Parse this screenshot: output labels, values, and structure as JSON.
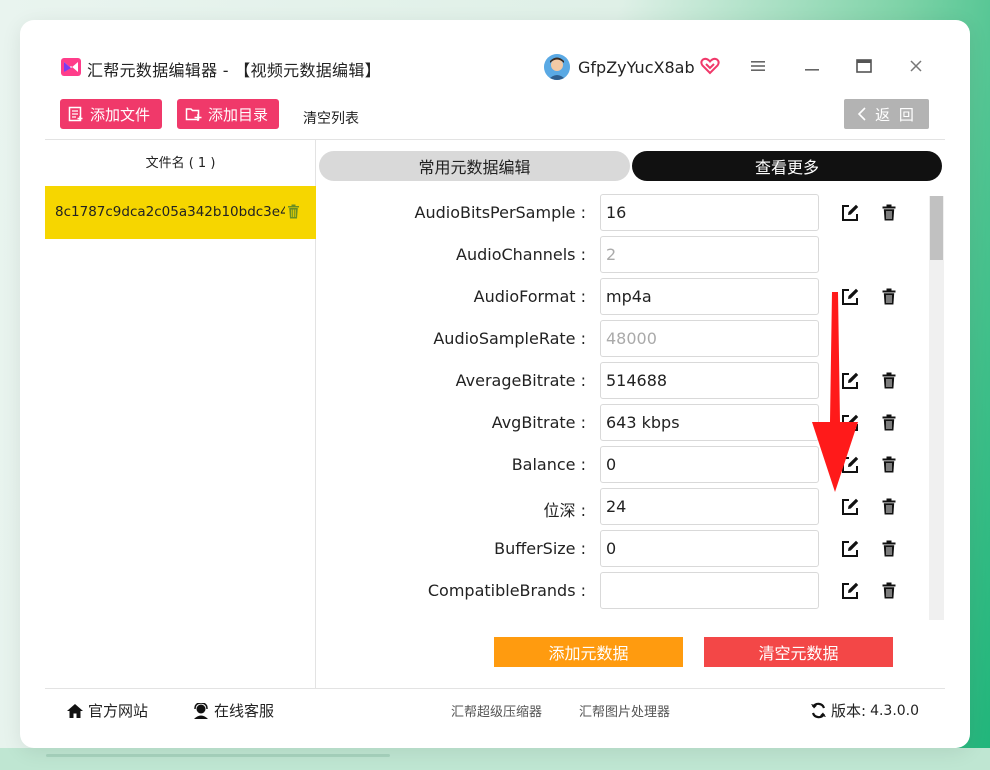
{
  "window": {
    "title": "汇帮元数据编辑器 - 【视频元数据编辑】",
    "username": "GfpZyYucX8ab"
  },
  "toolbar": {
    "add_file": "添加文件",
    "add_folder": "添加目录",
    "clear_list": "清空列表",
    "back": "返 回"
  },
  "file_list": {
    "header": "文件名 ( 1 )",
    "items": [
      {
        "name": "8c1787c9dca2c05a342b10bdc3e4"
      }
    ]
  },
  "tabs": [
    {
      "label": "常用元数据编辑",
      "active": false
    },
    {
      "label": "查看更多",
      "active": true
    }
  ],
  "metadata": [
    {
      "label": "AudioBitsPerSample :",
      "value": "16",
      "editable": true
    },
    {
      "label": "AudioChannels :",
      "value": "2",
      "editable": false
    },
    {
      "label": "AudioFormat :",
      "value": "mp4a",
      "editable": true
    },
    {
      "label": "AudioSampleRate :",
      "value": "48000",
      "editable": false
    },
    {
      "label": "AverageBitrate :",
      "value": "514688",
      "editable": true
    },
    {
      "label": "AvgBitrate :",
      "value": "643 kbps",
      "editable": true
    },
    {
      "label": "Balance :",
      "value": "0",
      "editable": true
    },
    {
      "label": "位深 :",
      "value": "24",
      "editable": true
    },
    {
      "label": "BufferSize :",
      "value": "0",
      "editable": true
    },
    {
      "label": "CompatibleBrands :",
      "value": "",
      "editable": true
    }
  ],
  "actions": {
    "add_metadata": "添加元数据",
    "clear_metadata": "清空元数据"
  },
  "footer": {
    "website": "官方网站",
    "support": "在线客服",
    "compressor": "汇帮超级压缩器",
    "image_processor": "汇帮图片处理器",
    "version_label": "版本:",
    "version": "4.3.0.0"
  },
  "colors": {
    "accent_pink": "#f0396a",
    "file_highlight": "#f6d600",
    "add_button": "#ff9b0f",
    "clear_button": "#f34747",
    "arrow": "#ff1a1a"
  }
}
